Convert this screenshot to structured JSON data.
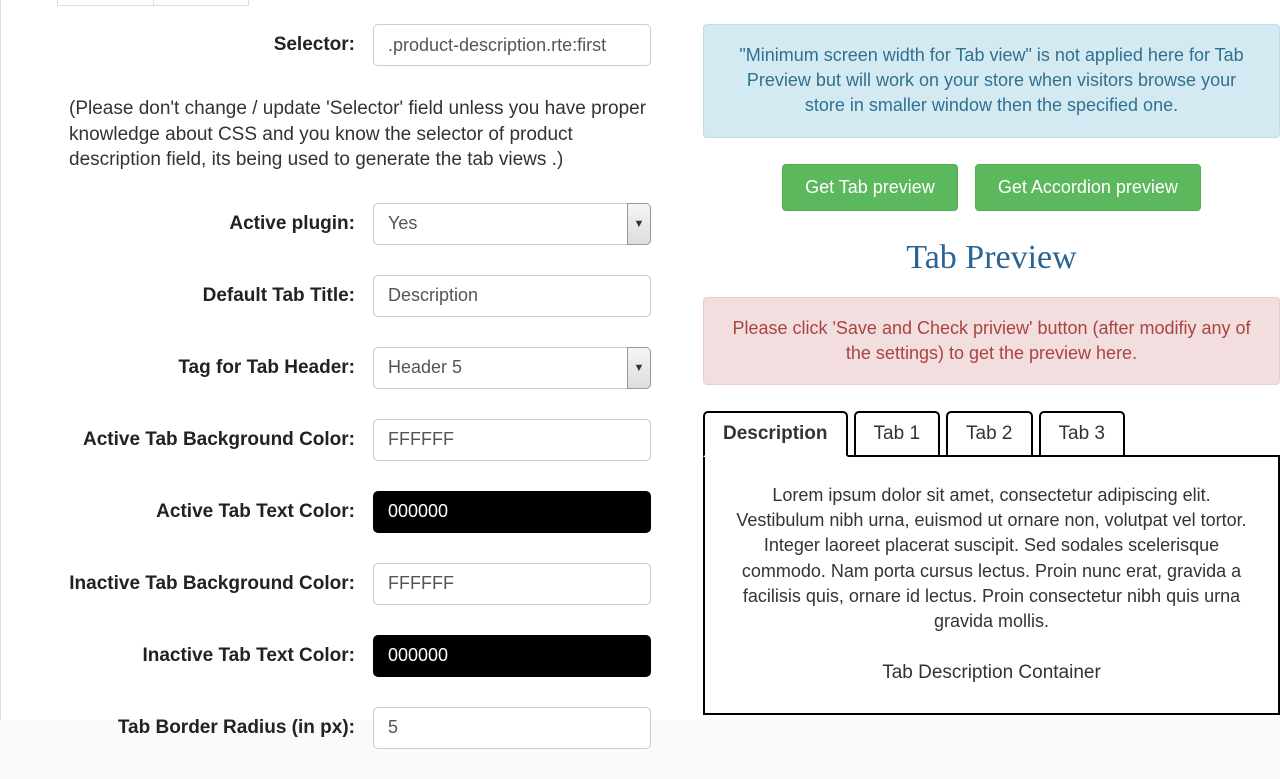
{
  "form": {
    "selector": {
      "label": "Selector:",
      "value": ".product-description.rte:first"
    },
    "selector_hint": "(Please don't change / update 'Selector' field unless you have proper knowledge about CSS and you know the selector of product description field, its being used to generate the tab views .)",
    "active_plugin": {
      "label": "Active plugin:",
      "value": "Yes"
    },
    "default_tab_title": {
      "label": "Default Tab Title:",
      "value": "Description"
    },
    "tag_header": {
      "label": "Tag for Tab Header:",
      "value": "Header 5"
    },
    "active_bg": {
      "label": "Active Tab Background Color:",
      "value": "FFFFFF"
    },
    "active_text": {
      "label": "Active Tab Text Color:",
      "value": "000000"
    },
    "inactive_bg": {
      "label": "Inactive Tab Background Color:",
      "value": "FFFFFF"
    },
    "inactive_text": {
      "label": "Inactive Tab Text Color:",
      "value": "000000"
    },
    "border_radius": {
      "label": "Tab Border Radius (in px):",
      "value": "5"
    }
  },
  "right": {
    "info": "\"Minimum screen width for Tab view\" is not applied here for Tab Preview but will work on your store when visitors browse your store in smaller window then the specified one.",
    "btn_tab": "Get Tab preview",
    "btn_accordion": "Get Accordion preview",
    "preview_title": "Tab Preview",
    "warning": "Please click 'Save and Check priview' button (after modifiy any of the settings) to get the preview here.",
    "tabs": [
      "Description",
      "Tab 1",
      "Tab 2",
      "Tab 3"
    ],
    "lorem": "Lorem ipsum dolor sit amet, consectetur adipiscing elit. Vestibulum nibh urna, euismod ut ornare non, volutpat vel tortor. Integer laoreet placerat suscipit. Sed sodales scelerisque commodo. Nam porta cursus lectus. Proin nunc erat, gravida a facilisis quis, ornare id lectus. Proin consectetur nibh quis urna gravida mollis.",
    "container_label": "Tab Description Container"
  }
}
